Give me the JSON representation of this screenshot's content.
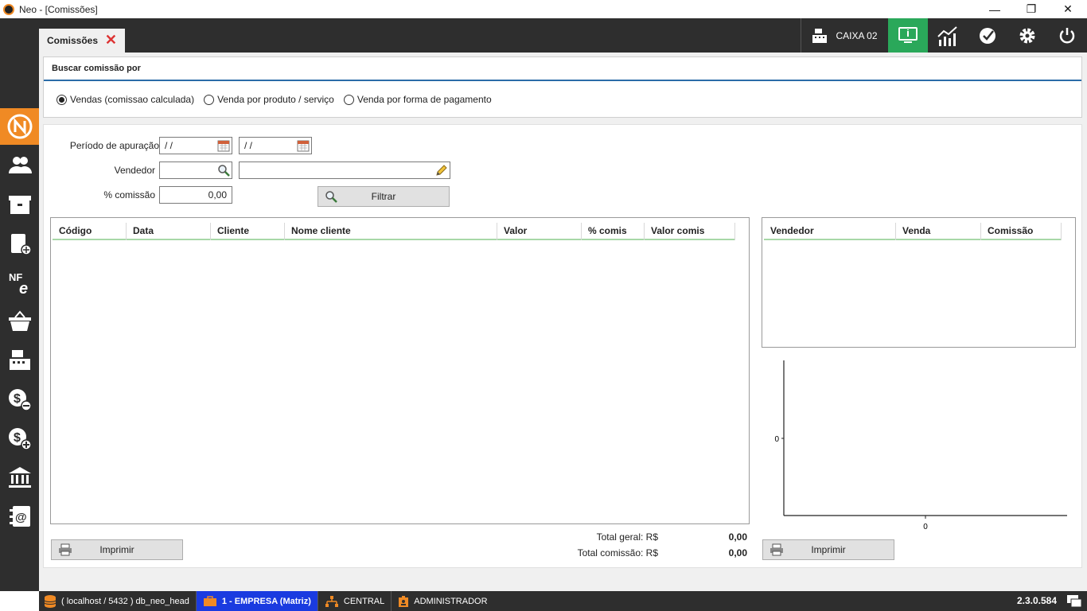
{
  "window": {
    "title": "Neo - [Comissões]",
    "minimize": "—",
    "restore": "❐",
    "close": "✕"
  },
  "tab": {
    "label": "Comissões",
    "close": "✕"
  },
  "topbar": {
    "caixa_label": "CAIXA 02"
  },
  "search_panel": {
    "heading": "Buscar comissão por",
    "options": [
      {
        "label": "Vendas (comissao calculada)",
        "selected": true
      },
      {
        "label": "Venda por produto / serviço",
        "selected": false
      },
      {
        "label": "Venda por forma de pagamento",
        "selected": false
      }
    ]
  },
  "filters": {
    "periodo_label": "Período de apuração",
    "date_from": " / /",
    "date_to": " / /",
    "vendedor_label": "Vendedor",
    "vendedor_code": "",
    "vendedor_name": "",
    "comissao_label": "% comissão",
    "comissao_value": "0,00",
    "filter_button": "Filtrar"
  },
  "main_grid": {
    "columns": [
      "Código",
      "Data",
      "Cliente",
      "Nome cliente",
      "Valor",
      "% comis",
      "Valor comis"
    ]
  },
  "side_grid": {
    "columns": [
      "Vendedor",
      "Venda",
      "Comissão"
    ]
  },
  "chart_data": {
    "type": "bar",
    "categories": [
      "0"
    ],
    "values": [],
    "title": "",
    "xlabel": "",
    "ylabel": "",
    "y_tick_labels": [
      "0"
    ],
    "x_tick_labels": [
      "0"
    ]
  },
  "totals": {
    "geral_label": "Total geral: R$",
    "geral_value": "0,00",
    "comissao_label": "Total comissão: R$",
    "comissao_value": "0,00"
  },
  "buttons": {
    "print_left": "Imprimir",
    "print_right": "Imprimir"
  },
  "statusbar": {
    "db": "( localhost / 5432 ) db_neo_head",
    "empresa": "1 - EMPRESA (Matriz)",
    "central": "CENTRAL",
    "user": "ADMINISTRADOR",
    "version": "2.3.0.584"
  },
  "colors": {
    "accent_orange": "#f08a24",
    "dark": "#2e2e2e",
    "green": "#2aa85a",
    "blue": "#1a3be0"
  }
}
